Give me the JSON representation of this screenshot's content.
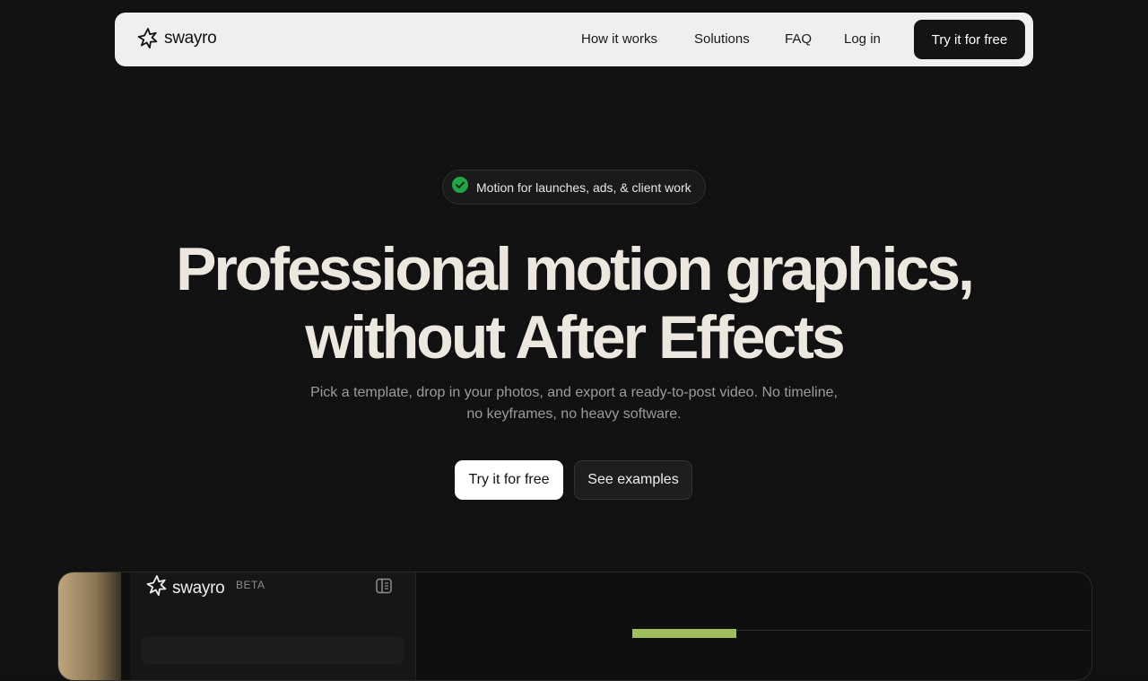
{
  "nav": {
    "logo_text": "swayro",
    "links": [
      {
        "label": "How it works"
      },
      {
        "label": "Solutions"
      },
      {
        "label": "FAQ"
      },
      {
        "label": "Log in"
      }
    ],
    "cta_label": "Try it for free"
  },
  "hero": {
    "badge_text": "Motion for launches, ads, & client work",
    "title_line1": "Professional motion graphics,",
    "title_line2": "without After Effects",
    "subtitle": "Pick a template, drop in your photos, and export a ready-to-post video. No timeline, no keyframes, no heavy software.",
    "primary_cta": "Try it for free",
    "secondary_cta": "See examples"
  },
  "preview": {
    "logo_text": "swayro",
    "beta_label": "BETA"
  },
  "colors": {
    "background": "#111112",
    "nav_background": "#efefef",
    "accent_green": "#22a447",
    "preview_bar": "#9fbf5c"
  },
  "icons": {
    "logo": "flower-star-icon",
    "badge": "check-circle-icon",
    "panel_toggle": "sidebar-toggle-icon"
  }
}
